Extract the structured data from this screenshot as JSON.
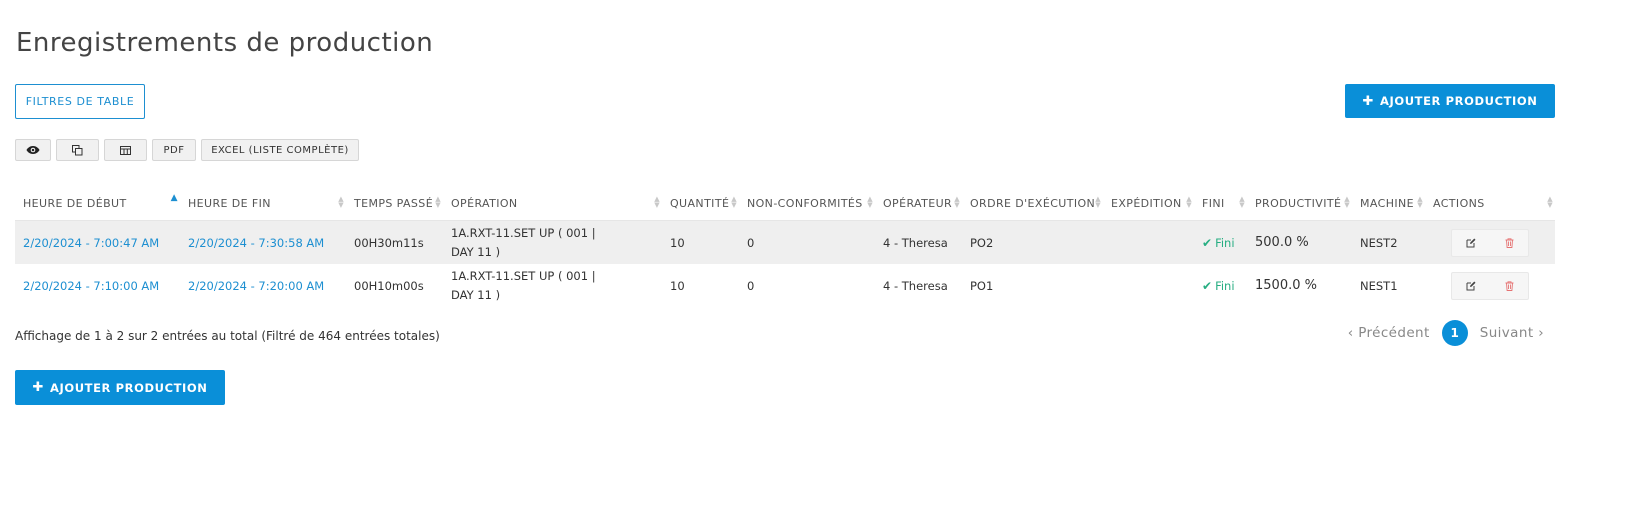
{
  "page": {
    "title": "Enregistrements de production"
  },
  "buttons": {
    "table_filters": "FILTRES DE TABLE",
    "add_production_top": "AJOUTER PRODUCTION",
    "add_production_bottom": "AJOUTER PRODUCTION",
    "plus_glyph": "✚"
  },
  "toolbar": {
    "view_icon": "eye-icon",
    "copy_icon": "copy-icon",
    "columns_icon": "columns-icon",
    "pdf": "PDF",
    "excel": "EXCEL (LISTE COMPLÈTE)"
  },
  "table": {
    "columns": [
      "HEURE DE DÉBUT",
      "HEURE DE FIN",
      "TEMPS PASSÉ",
      "OPÉRATION",
      "QUANTITÉ",
      "NON-CONFORMITÉS",
      "OPÉRATEUR",
      "ORDRE D'EXÉCUTION",
      "EXPÉDITION",
      "FINI",
      "PRODUCTIVITÉ",
      "MACHINE",
      "ACTIONS"
    ],
    "sorted_column": "HEURE DE DÉBUT",
    "sort_direction": "ascending",
    "rows": [
      {
        "start": "2/20/2024 - 7:00:47 AM",
        "end": "2/20/2024 - 7:30:58 AM",
        "time_spent": "00H30m11s",
        "operation_line1": "1A.RXT-11.SET UP ( 001 |",
        "operation_line2": "DAY 11 )",
        "quantity": "10",
        "nonconformities": "0",
        "operator": "4 - Theresa",
        "work_order": "PO2",
        "shipping": "",
        "fini_check": "✔",
        "fini": "Fini",
        "productivity": "500.0 %",
        "machine": "NEST2"
      },
      {
        "start": "2/20/2024 - 7:10:00 AM",
        "end": "2/20/2024 - 7:20:00 AM",
        "time_spent": "00H10m00s",
        "operation_line1": "1A.RXT-11.SET UP ( 001 |",
        "operation_line2": "DAY 11 )",
        "quantity": "10",
        "nonconformities": "0",
        "operator": "4 - Theresa",
        "work_order": "PO1",
        "shipping": "",
        "fini_check": "✔",
        "fini": "Fini",
        "productivity": "1500.0 %",
        "machine": "NEST1"
      }
    ]
  },
  "footer": {
    "info": "Affichage de 1 à 2 sur 2 entrées au total (Filtré de 464 entrées totales)",
    "previous": "‹ Précédent",
    "current_page": "1",
    "next": "Suivant ›"
  },
  "colors": {
    "accent": "#0a8fd8",
    "link": "#1d8fd1",
    "success": "#27ae82",
    "delete": "#e57373"
  }
}
